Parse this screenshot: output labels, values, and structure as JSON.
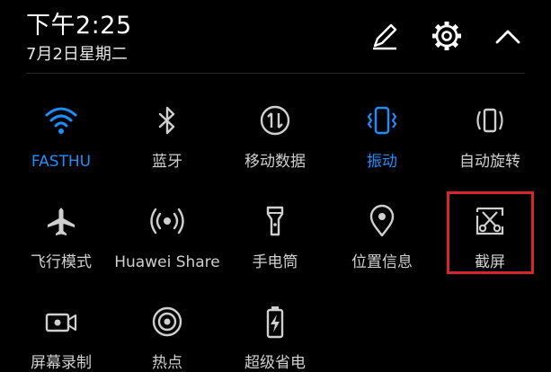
{
  "status": {
    "time": "下午2:25",
    "date": "7月2日星期二"
  },
  "header_icons": [
    "edit-pencil-icon",
    "settings-gear-icon",
    "collapse-chevron-up-icon"
  ],
  "colors": {
    "background": "#000000",
    "active": "#1a8fff",
    "inactive": "#cfcfcf",
    "highlight_box": "#d6262c"
  },
  "tiles": [
    {
      "label": "FASTHU",
      "icon": "wifi-icon",
      "active": true
    },
    {
      "label": "蓝牙",
      "icon": "bluetooth-icon",
      "active": false
    },
    {
      "label": "移动数据",
      "icon": "mobile-data-icon",
      "active": false
    },
    {
      "label": "振动",
      "icon": "vibrate-icon",
      "active": true
    },
    {
      "label": "自动旋转",
      "icon": "auto-rotate-icon",
      "active": false
    },
    {
      "label": "飞行模式",
      "icon": "airplane-icon",
      "active": false
    },
    {
      "label": "Huawei Share",
      "icon": "huawei-share-icon",
      "active": false
    },
    {
      "label": "手电筒",
      "icon": "flashlight-icon",
      "active": false
    },
    {
      "label": "位置信息",
      "icon": "location-pin-icon",
      "active": false
    },
    {
      "label": "截屏",
      "icon": "screenshot-scissors-icon",
      "active": false
    },
    {
      "label": "屏幕录制",
      "icon": "screen-record-icon",
      "active": false
    },
    {
      "label": "热点",
      "icon": "hotspot-icon",
      "active": false
    },
    {
      "label": "超级省电",
      "icon": "power-saving-icon",
      "active": false
    }
  ]
}
